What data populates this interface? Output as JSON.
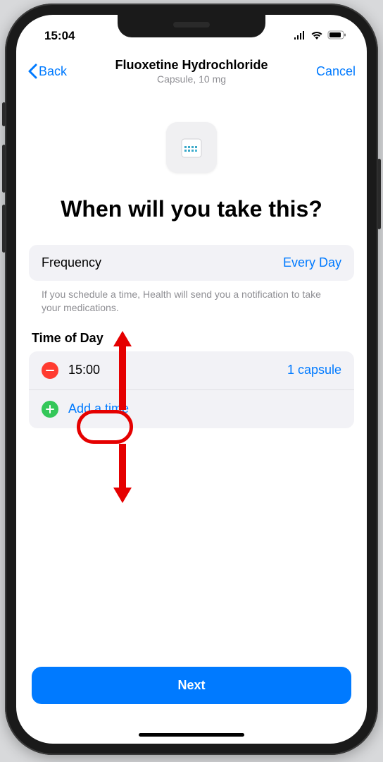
{
  "status_bar": {
    "time": "15:04"
  },
  "nav": {
    "back_label": "Back",
    "title": "Fluoxetine Hydrochloride",
    "subtitle": "Capsule, 10 mg",
    "cancel_label": "Cancel"
  },
  "page": {
    "heading": "When will you take this?",
    "frequency_label": "Frequency",
    "frequency_value": "Every Day",
    "help_text": "If you schedule a time, Health will send you a notification to take your medications.",
    "time_section_header": "Time of Day",
    "times": [
      {
        "time": "15:00",
        "dose": "1 capsule"
      }
    ],
    "add_time_label": "Add a time",
    "next_label": "Next"
  }
}
